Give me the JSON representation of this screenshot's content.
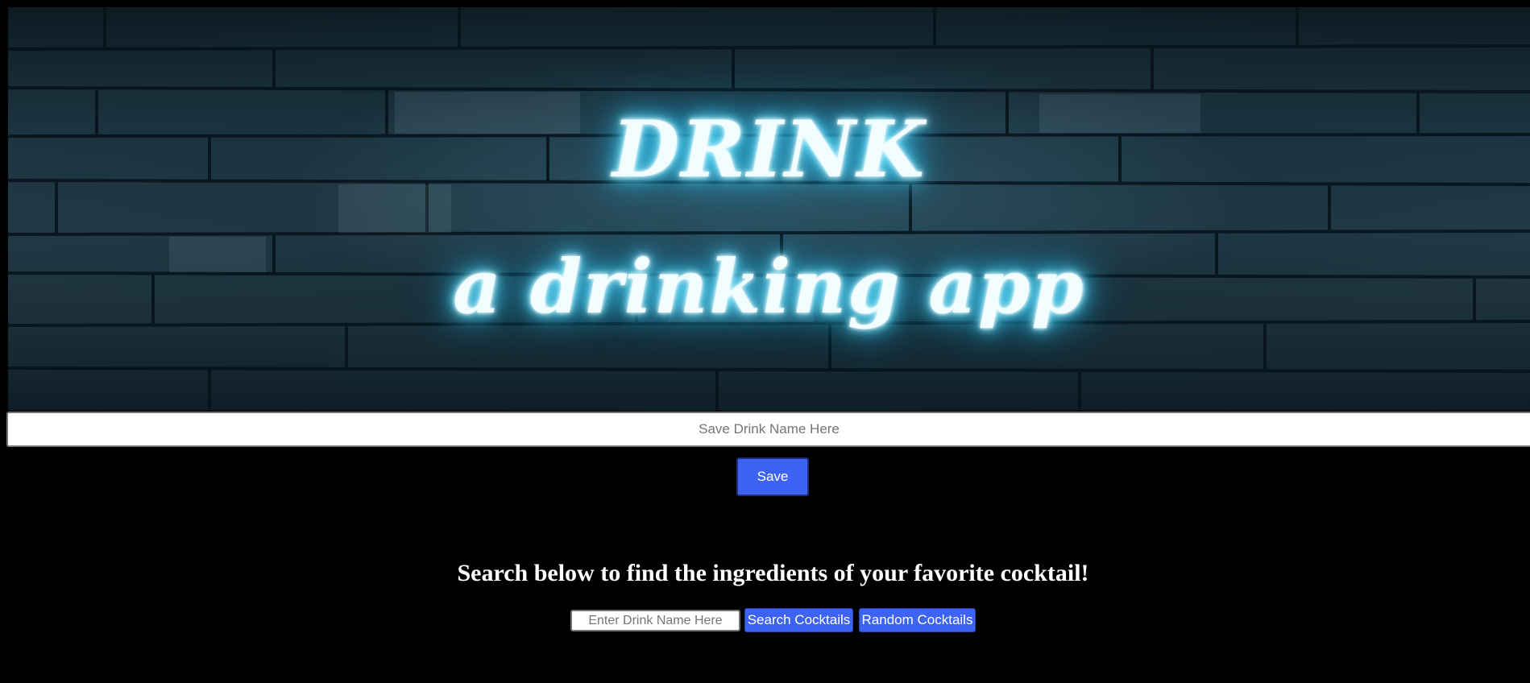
{
  "hero": {
    "title": "DRINK",
    "subtitle": "a drinking app"
  },
  "save": {
    "input_placeholder": "Save Drink Name Here",
    "input_value": "",
    "button_label": "Save"
  },
  "search": {
    "heading": "Search below to find the ingredients of your favorite cocktail!",
    "input_placeholder": "Enter Drink Name Here",
    "input_value": "",
    "search_button_label": "Search Cocktails",
    "random_button_label": "Random Cocktails"
  },
  "colors": {
    "background": "#000000",
    "button": "#3d63f5",
    "neon_glow": "#2bc8ff"
  }
}
